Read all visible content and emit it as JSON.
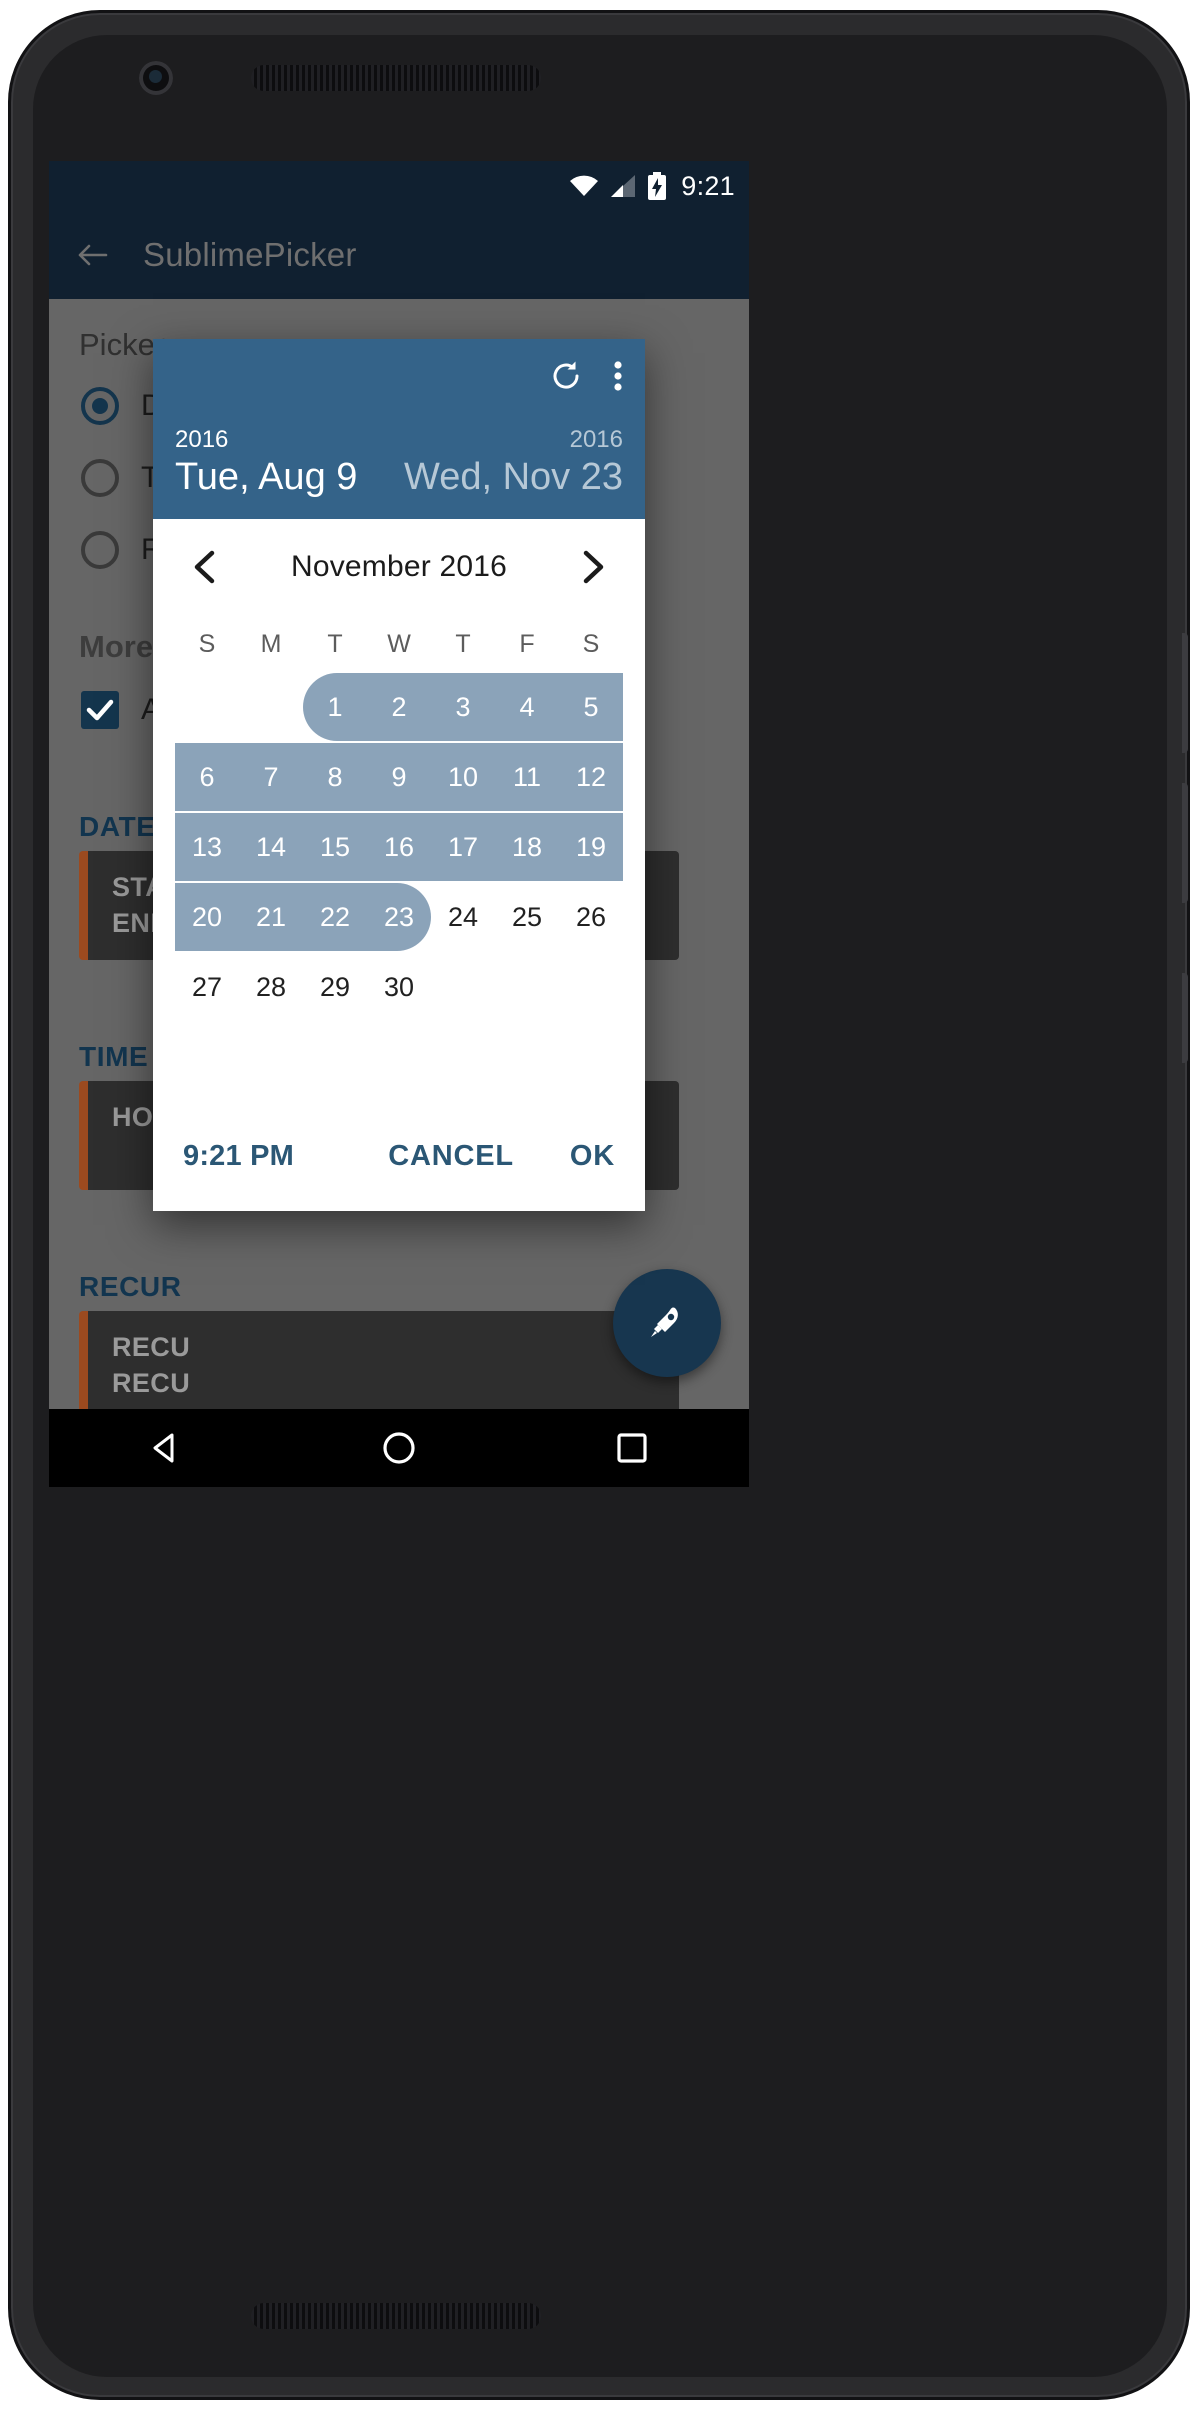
{
  "device": {
    "front_camera": "front-camera",
    "earpiece": "earpiece-speaker"
  },
  "status_bar": {
    "wifi_icon": "wifi-icon",
    "signal_icon": "cell-signal-icon",
    "battery_icon": "battery-charging-icon",
    "clock": "9:21"
  },
  "app_bar": {
    "back_icon": "back-arrow-icon",
    "title": "SublimePicker"
  },
  "background": {
    "picker_label": "Picker",
    "radio_options": [
      {
        "label": "D",
        "checked": true
      },
      {
        "label": "T",
        "checked": false
      },
      {
        "label": "R",
        "checked": false
      }
    ],
    "more_label": "More",
    "checkbox": {
      "label": "A",
      "checked": true
    },
    "sections": [
      {
        "heading": "DATE",
        "lines": [
          "STAR",
          "END:"
        ]
      },
      {
        "heading": "TIME",
        "lines": [
          "HOU"
        ]
      },
      {
        "heading": "RECUR",
        "lines": [
          "RECU",
          "RECU"
        ]
      }
    ],
    "fab_icon": "rocket-icon"
  },
  "dialog": {
    "header": {
      "refresh_icon": "refresh-icon",
      "overflow_icon": "overflow-menu-icon",
      "start": {
        "year": "2016",
        "date": "Tue, Aug 9"
      },
      "end": {
        "year": "2016",
        "date": "Wed, Nov 23"
      }
    },
    "month_nav": {
      "prev_icon": "chevron-left-icon",
      "title": "November 2016",
      "next_icon": "chevron-right-icon"
    },
    "calendar": {
      "weekdays": [
        "S",
        "M",
        "T",
        "W",
        "T",
        "F",
        "S"
      ],
      "weeks": [
        {
          "days": [
            "",
            "",
            "1",
            "2",
            "3",
            "4",
            "5"
          ],
          "selected": [
            false,
            false,
            true,
            true,
            true,
            true,
            true
          ],
          "round_start": true,
          "round_end": false
        },
        {
          "days": [
            "6",
            "7",
            "8",
            "9",
            "10",
            "11",
            "12"
          ],
          "selected": [
            true,
            true,
            true,
            true,
            true,
            true,
            true
          ],
          "round_start": false,
          "round_end": false
        },
        {
          "days": [
            "13",
            "14",
            "15",
            "16",
            "17",
            "18",
            "19"
          ],
          "selected": [
            true,
            true,
            true,
            true,
            true,
            true,
            true
          ],
          "round_start": false,
          "round_end": false
        },
        {
          "days": [
            "20",
            "21",
            "22",
            "23",
            "24",
            "25",
            "26"
          ],
          "selected": [
            true,
            true,
            true,
            true,
            false,
            false,
            false
          ],
          "round_start": false,
          "round_end": true
        },
        {
          "days": [
            "27",
            "28",
            "29",
            "30",
            "",
            "",
            ""
          ],
          "selected": [
            false,
            false,
            false,
            false,
            false,
            false,
            false
          ],
          "round_start": false,
          "round_end": false
        }
      ]
    },
    "footer": {
      "time": "9:21 PM",
      "cancel": "CANCEL",
      "ok": "OK"
    }
  },
  "nav_bar": {
    "back_icon": "nav-back-triangle-icon",
    "home_icon": "nav-home-circle-icon",
    "recents_icon": "nav-recents-square-icon"
  },
  "colors": {
    "app_bar": "#102030",
    "dialog_header": "#346389",
    "range_band": "#8ba3b9",
    "accent_text": "#2b5775",
    "scrim": "#666666",
    "card_border": "#9c4a1f"
  }
}
